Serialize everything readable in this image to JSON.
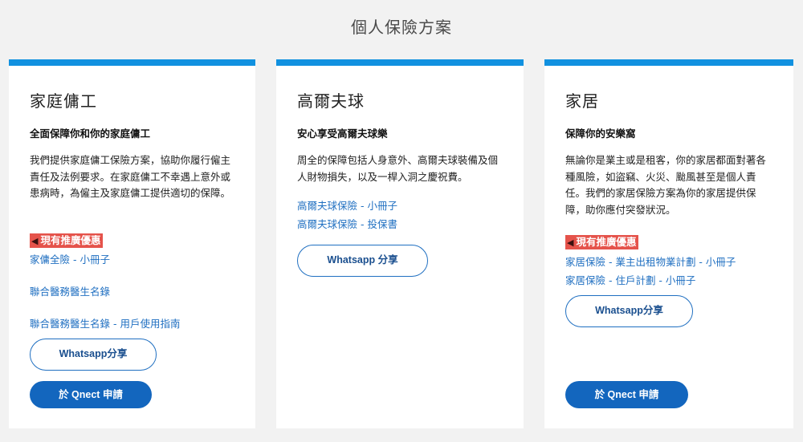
{
  "page": {
    "title": "個人保險方案"
  },
  "cards": [
    {
      "title": "家庭傭工",
      "subtitle": "全面保障你和你的家庭傭工",
      "description": "我們提供家庭傭工保險方案，協助你履行僱主責任及法例要求。在家庭傭工不幸遇上意外或患病時，為僱主及家庭傭工提供適切的保障。",
      "promo": "現有推廣優惠",
      "links": [
        "家傭全險 - 小冊子",
        "聯合醫務醫生名錄",
        "聯合醫務醫生名錄 - 用戶使用指南"
      ],
      "whatsapp_label": "Whatsapp分享",
      "apply_label": "於 Qnect 申請"
    },
    {
      "title": "高爾夫球",
      "subtitle": "安心享受高爾夫球樂",
      "description": "周全的保障包括人身意外、高爾夫球裝備及個人財物損失，以及一桿入洞之慶祝費。",
      "links": [
        "高爾夫球保險 - 小冊子",
        "高爾夫球保險 - 投保書"
      ],
      "whatsapp_label": "Whatsapp 分享"
    },
    {
      "title": "家居",
      "subtitle": "保障你的安樂窩",
      "description": "無論你是業主或是租客，你的家居都面對著各種風險，如盜竊、火災、颱風甚至是個人責任。我們的家居保險方案為你的家居提供保障，助你應付突發狀況。",
      "promo": "現有推廣優惠",
      "links": [
        "家居保險 - 業主出租物業計劃 - 小冊子",
        "家居保險 - 住戶計劃 - 小冊子"
      ],
      "whatsapp_label": "Whatsapp分享",
      "apply_label": "於 Qnect 申請"
    }
  ],
  "colors": {
    "accent_bar": "#1191e0",
    "link": "#1f6fc1",
    "button_solid": "#1366be",
    "promo_bg": "#e5534b"
  },
  "icons": {
    "promo": "speaker-icon"
  }
}
